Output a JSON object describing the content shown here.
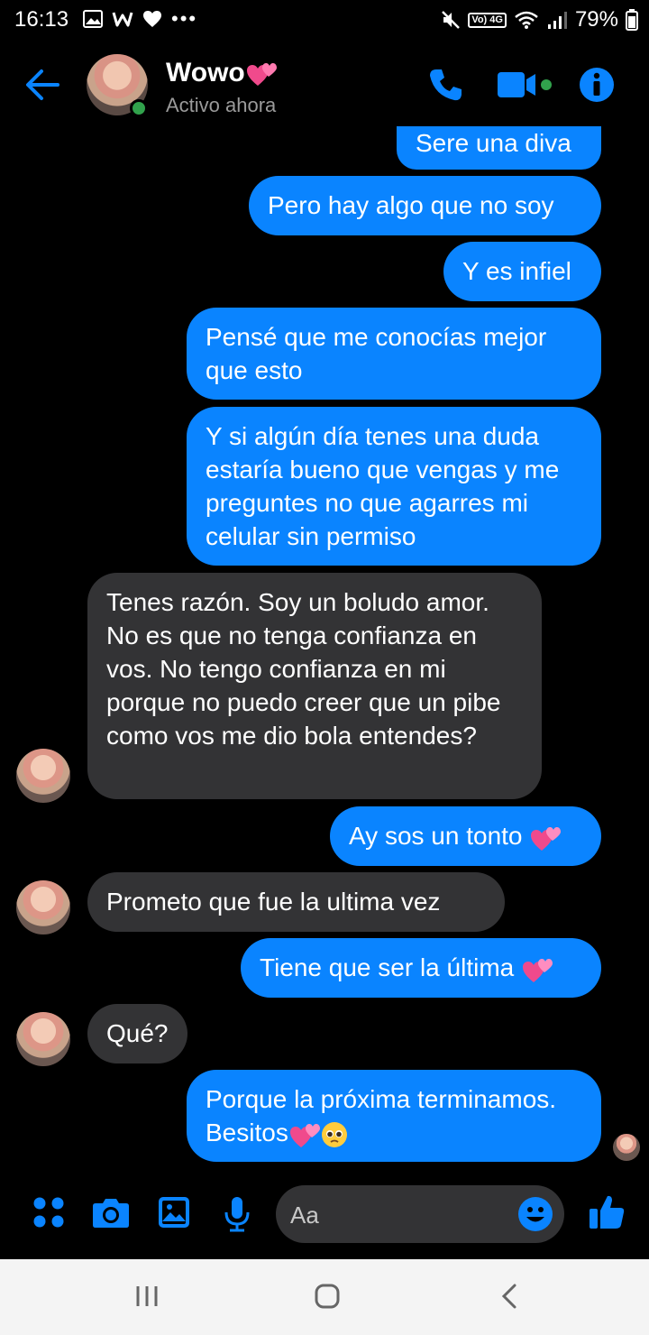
{
  "status_bar": {
    "time": "16:13",
    "network_label": "Vo) 4G",
    "battery": "79%"
  },
  "header": {
    "contact_name": "Wowo",
    "contact_status": "Activo ahora",
    "icons": [
      "back-arrow-icon",
      "phone-icon",
      "video-call-icon",
      "info-icon"
    ],
    "accent_color": "#0a84ff"
  },
  "messages": [
    {
      "dir": "out",
      "text": "Sere una diva"
    },
    {
      "dir": "out",
      "text": "Pero hay algo que no soy"
    },
    {
      "dir": "out",
      "text": "Y es infiel"
    },
    {
      "dir": "out",
      "text": "Pensé que me conocías mejor que esto"
    },
    {
      "dir": "out",
      "text": "Y si algún día tenes una duda estaría bueno que vengas y me preguntes no que agarres mi celular sin permiso"
    },
    {
      "dir": "in",
      "text": "Tenes razón. Soy un boludo amor. No es que no tenga confianza en vos. No tengo confianza en mi porque no puedo creer que un pibe como vos me dio bola entendes?"
    },
    {
      "dir": "out",
      "text": "Ay sos un tonto"
    },
    {
      "dir": "in",
      "text": "Prometo que fue la ultima vez"
    },
    {
      "dir": "out",
      "text": "Tiene que ser la última"
    },
    {
      "dir": "in",
      "text": "Qué?"
    },
    {
      "dir": "out",
      "text": "Porque la próxima terminamos. Besitos"
    }
  ],
  "composer": {
    "placeholder": "Aa",
    "icons": [
      "apps-icon",
      "camera-icon",
      "gallery-icon",
      "microphone-icon",
      "emoji-icon",
      "like-thumb-icon"
    ]
  },
  "colors": {
    "outgoing_bubble": "#0a84ff",
    "incoming_bubble": "#333335",
    "online": "#31a24c"
  }
}
